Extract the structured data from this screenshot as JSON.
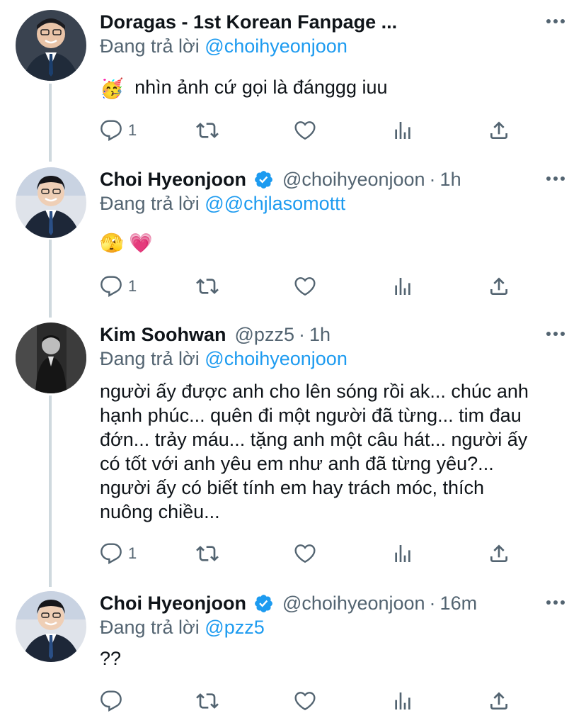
{
  "tweets": [
    {
      "name": "Doragas - 1st Korean Fanpage ...",
      "verified": false,
      "handle": "",
      "time": "",
      "reply_prefix": "Đang trả lời",
      "reply_mention": "@choihyeonjoon",
      "text_lines": [
        "nhìn ảnh cứ gọi là đánggg iuu"
      ],
      "emoji_prefix": "🥳",
      "reply_count": "1",
      "avatar": "smiling-man-suit-avatar"
    },
    {
      "name": "Choi Hyeonjoon",
      "verified": true,
      "handle": "@choihyeonjoon",
      "time": "1h",
      "reply_prefix": "Đang trả lời",
      "reply_mention": "@@chjlasomottt",
      "text_lines": [
        "🫣 💗"
      ],
      "reply_count": "1",
      "avatar": "smiling-man-suit-avatar"
    },
    {
      "name": "Kim Soohwan",
      "verified": false,
      "handle": "@pzz5",
      "time": "1h",
      "reply_prefix": "Đang trả lời",
      "reply_mention": "@choihyeonjoon",
      "text_lines": [
        "người ấy được anh cho lên sóng rồi ak... chúc anh",
        "hạnh phúc... quên đi một người đã từng... tim đau",
        "đớn... trảy máu... tặng anh một câu hát... người ấy",
        "có tốt với anh yêu em như anh đã từng yêu?...",
        "người ấy có biết tính em hay trách móc, thích",
        "nuông chiều..."
      ],
      "reply_count": "1",
      "avatar": "monochrome-man-suit-avatar"
    },
    {
      "name": "Choi Hyeonjoon",
      "verified": true,
      "handle": "@choihyeonjoon",
      "time": "16m",
      "reply_prefix": "Đang trả lời",
      "reply_mention": "@pzz5",
      "text_lines": [
        "??"
      ],
      "reply_count": "",
      "avatar": "smiling-man-suit-avatar"
    }
  ],
  "icons": {
    "reply": "reply-icon",
    "retweet": "retweet-icon",
    "like": "like-icon",
    "analytics": "analytics-icon",
    "share": "share-icon",
    "more": "more-icon",
    "verified": "verified-badge-icon"
  },
  "colors": {
    "link": "#1d9bf0",
    "muted": "#536471",
    "thread_line": "#cfd9de",
    "verified": "#1d9bf0"
  }
}
